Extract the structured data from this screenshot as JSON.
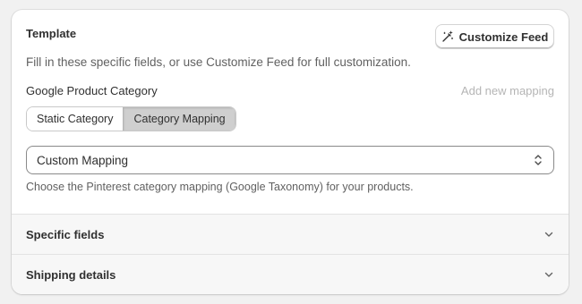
{
  "template": {
    "title": "Template",
    "customize_button": "Customize Feed",
    "description": "Fill in these specific fields, or use Customize Feed for full customization."
  },
  "category": {
    "label": "Google Product Category",
    "add_mapping": "Add new mapping",
    "tabs": [
      {
        "label": "Static Category",
        "active": false
      },
      {
        "label": "Category Mapping",
        "active": true
      }
    ],
    "select_value": "Custom Mapping",
    "help_text": "Choose the Pinterest category mapping (Google Taxonomy) for your products."
  },
  "sections": [
    {
      "label": "Specific fields",
      "icon": "chevron-down-icon"
    },
    {
      "label": "Shipping details",
      "icon": "chevron-down-icon"
    }
  ],
  "icons": {
    "customize": "magic-wand-icon",
    "select": "select-chevrons-icon"
  },
  "colors": {
    "card_bg": "#ffffff",
    "page_bg": "#f1f1f1",
    "active_tab_bg": "#cfcfcf",
    "section_bg": "#f7f7f7",
    "muted_text": "#616161",
    "disabled_link": "#b5b5b5"
  }
}
